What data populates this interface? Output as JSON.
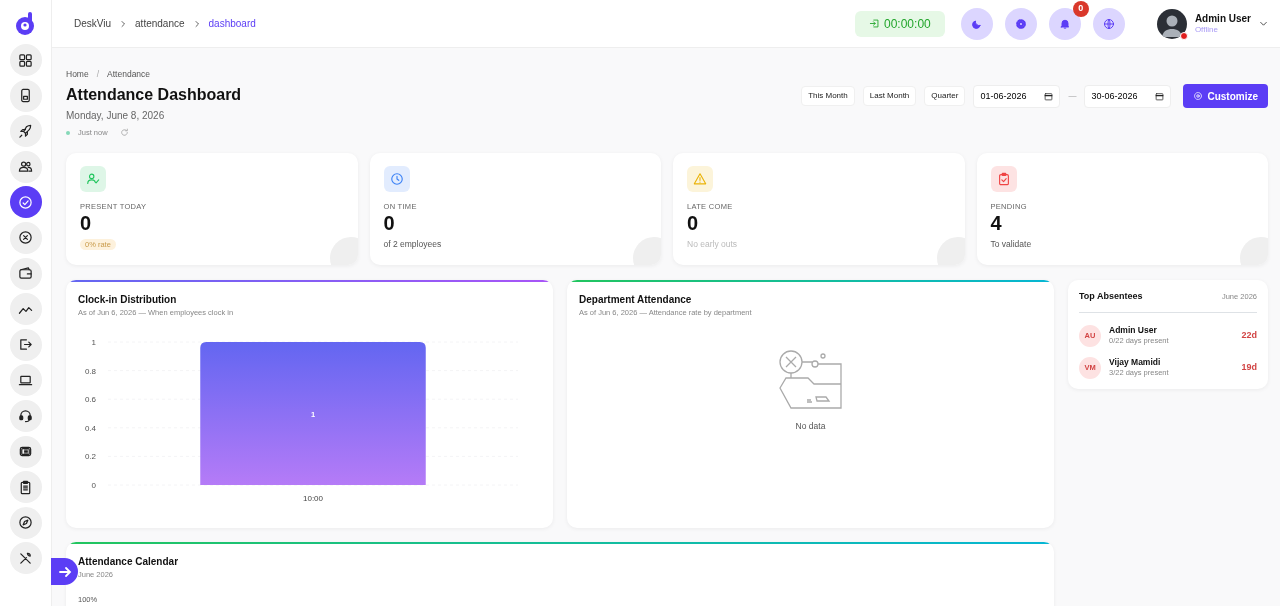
{
  "header": {
    "breadcrumb": [
      {
        "label": "DeskViu",
        "selected": false
      },
      {
        "label": "attendance",
        "selected": false
      },
      {
        "label": "dashboard",
        "selected": true
      }
    ],
    "timer": "00:00:00",
    "notification_count": "0",
    "user": {
      "name": "Admin User",
      "status": "Offline",
      "online": false
    }
  },
  "sidebar": {
    "items": [
      {
        "selected": false
      },
      {
        "selected": false
      },
      {
        "selected": false
      },
      {
        "selected": false
      },
      {
        "selected": true
      },
      {
        "selected": false
      },
      {
        "selected": false
      },
      {
        "selected": false
      },
      {
        "selected": false
      },
      {
        "selected": false
      },
      {
        "selected": false
      },
      {
        "selected": false
      },
      {
        "selected": false
      },
      {
        "selected": false
      },
      {
        "selected": false
      }
    ]
  },
  "page": {
    "breadcrumb": [
      "Home",
      "Attendance"
    ],
    "breadcrumb_separator": "/",
    "title": "Attendance Dashboard",
    "date": "Monday, June 8, 2026",
    "updated": "Just now"
  },
  "filters": {
    "ranges": [
      "This Month",
      "Last Month",
      "Quarter"
    ],
    "date_from": "01-06-2026",
    "separator": "—",
    "date_to": "30-06-2026",
    "customize": "Customize"
  },
  "stats": [
    {
      "label": "PRESENT TODAY",
      "value": "0",
      "note": "0% rate",
      "kind": "badge",
      "color": "#22c55e"
    },
    {
      "label": "ON TIME",
      "value": "0",
      "note": "of 2 employees",
      "kind": "text",
      "color": "#3b82f6"
    },
    {
      "label": "LATE COME",
      "value": "0",
      "note": "No early outs",
      "kind": "muted",
      "color": "#eab308"
    },
    {
      "label": "PENDING",
      "value": "4",
      "note": "To validate",
      "kind": "text",
      "color": "#ef4444"
    }
  ],
  "clock_in": {
    "title": "Clock-in Distribution",
    "subtitle": "As of Jun 6, 2026 — When employees clock in",
    "chart_data": {
      "type": "bar",
      "categories": [
        "10:00"
      ],
      "values": [
        1
      ],
      "ylim": [
        0,
        1
      ],
      "yticks": [
        0,
        0.2,
        0.4,
        0.6,
        0.8,
        1
      ],
      "grid": true,
      "data_labels": true
    }
  },
  "department": {
    "title": "Department Attendance",
    "subtitle": "As of Jun 6, 2026 — Attendance rate by department",
    "empty": "No data"
  },
  "top_absentees": {
    "title": "Top Absentees",
    "period": "June 2026",
    "items": [
      {
        "initials": "AU",
        "name": "Admin User",
        "detail": "0/22 days present",
        "days": "22d"
      },
      {
        "initials": "VM",
        "name": "Vijay Mamidi",
        "detail": "3/22 days present",
        "days": "19d"
      }
    ]
  },
  "calendar": {
    "title": "Attendance Calendar",
    "subtitle": "June 2026",
    "axis_label": "100%"
  }
}
